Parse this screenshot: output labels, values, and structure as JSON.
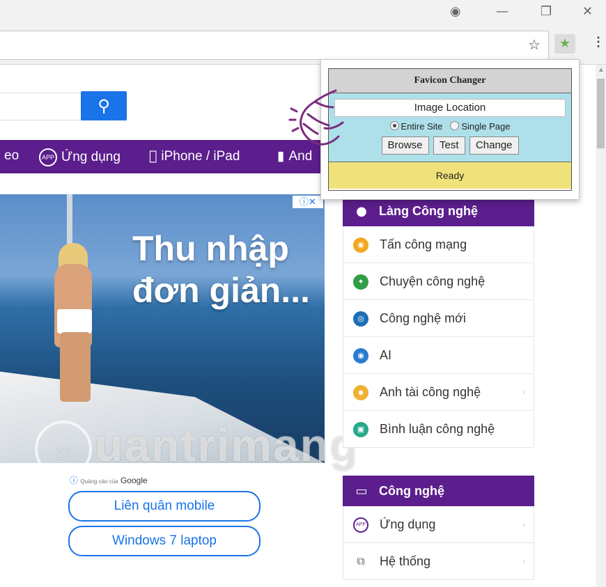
{
  "window": {
    "account_icon": "account-circle-icon",
    "minimize_icon": "minimize-icon",
    "restore_icon": "restore-icon",
    "close_icon": "close-icon"
  },
  "toolbar": {
    "bookmark_icon": "star-icon",
    "extension_icon": "favicon-changer-icon",
    "menu_icon": "menu-dots-icon"
  },
  "page": {
    "search_icon": "search-icon",
    "nav": [
      {
        "label": "eo"
      },
      {
        "label": "Ứng dụng"
      },
      {
        "label": "iPhone / iPad"
      },
      {
        "label": "And"
      }
    ],
    "ad": {
      "headline_line1": "Thu nhập",
      "headline_line2": "đơn giản...",
      "ad_choices": "ⓘ✕",
      "google_label_small": "Quảng cáo của",
      "google_label": "Google",
      "pills": [
        "Liên quân mobile",
        "Windows 7 laptop"
      ]
    },
    "watermark": "uantrimang",
    "sidebar": {
      "section1": {
        "title": "Làng Công nghệ",
        "items": [
          {
            "label": "Tấn công mạng",
            "color": "#f2a91f"
          },
          {
            "label": "Chuyện công nghệ",
            "color": "#2f9e44"
          },
          {
            "label": "Công nghệ mới",
            "color": "#1a6fb5"
          },
          {
            "label": "AI",
            "color": "#2b7bd0"
          },
          {
            "label": "Anh tài công nghệ",
            "color": "#f0b232"
          },
          {
            "label": "Bình luận công nghệ",
            "color": "#26a98b"
          }
        ]
      },
      "section2": {
        "title": "Công nghệ",
        "items": [
          {
            "label": "Ứng dụng",
            "color": "#5b1e8c"
          },
          {
            "label": "Hệ thống",
            "color": "#666666"
          }
        ]
      }
    }
  },
  "popup": {
    "title": "Favicon Changer",
    "image_location": "Image Location",
    "radio_entire": "Entire Site",
    "radio_single": "Single Page",
    "browse": "Browse",
    "test": "Test",
    "change": "Change",
    "status": "Ready"
  },
  "colors": {
    "brand_purple": "#5b1e8c",
    "search_blue": "#1a73e8",
    "popup_body": "#aee0ea",
    "popup_status": "#f0e27a"
  }
}
